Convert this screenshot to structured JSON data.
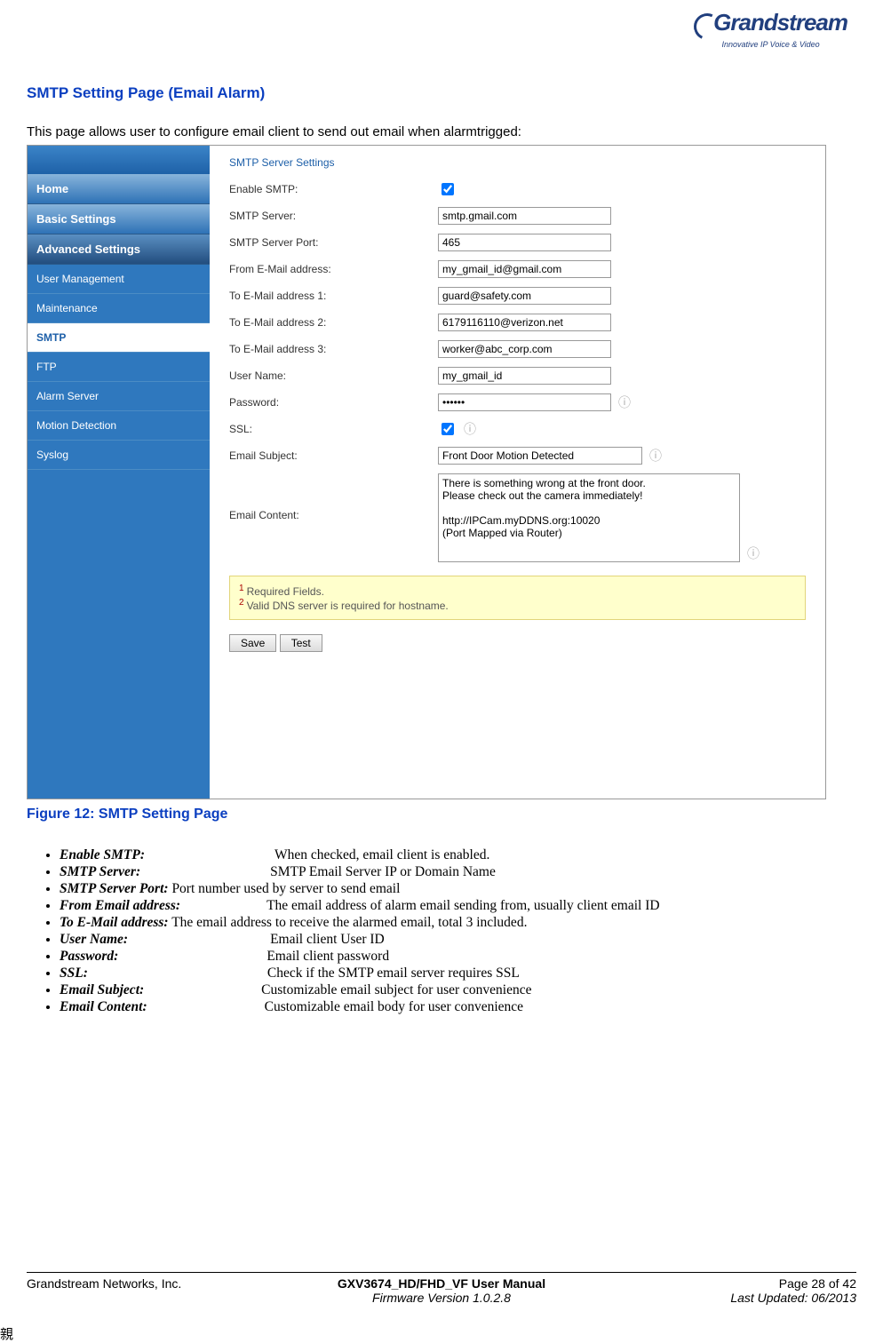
{
  "logo": {
    "brand": "Grandstream",
    "tagline": "Innovative IP Voice & Video"
  },
  "section_title": "SMTP Setting Page (Email Alarm)",
  "intro_text": "This page allows user to configure email client to send out email when alarmtrigged:",
  "sidebar": {
    "top_sections": [
      "Home",
      "Basic Settings",
      "Advanced Settings"
    ],
    "items": [
      "User Management",
      "Maintenance",
      "SMTP",
      "FTP",
      "Alarm Server",
      "Motion Detection",
      "Syslog"
    ],
    "active_index": 2
  },
  "panel": {
    "heading": "SMTP Server Settings",
    "labels": {
      "enable": "Enable SMTP:",
      "server": "SMTP Server:",
      "port": "SMTP Server Port:",
      "from": "From E-Mail address:",
      "to1": "To E-Mail address 1:",
      "to2": "To E-Mail address 2:",
      "to3": "To E-Mail address 3:",
      "user": "User Name:",
      "pass": "Password:",
      "ssl": "SSL:",
      "subj": "Email Subject:",
      "body": "Email Content:"
    },
    "values": {
      "enable": true,
      "server": "smtp.gmail.com",
      "port": "465",
      "from": "my_gmail_id@gmail.com",
      "to1": "guard@safety.com",
      "to2": "6179116110@verizon.net",
      "to3": "worker@abc_corp.com",
      "user": "my_gmail_id",
      "pass": "••••••",
      "ssl": true,
      "subj": "Front Door Motion Detected",
      "body": "There is something wrong at the front door.\nPlease check out the camera immediately!\n\nhttp://IPCam.myDDNS.org:10020\n(Port Mapped via Router)"
    },
    "notes": [
      "Required Fields.",
      "Valid DNS server is required for hostname."
    ],
    "buttons": {
      "save": "Save",
      "test": "Test"
    }
  },
  "fig_caption": "Figure 12:  SMTP Setting Page",
  "definitions": [
    {
      "term": "Enable SMTP:",
      "desc": "When checked, email client is enabled."
    },
    {
      "term": "SMTP Server:",
      "desc": "SMTP Email Server IP or Domain Name"
    },
    {
      "term": "SMTP Server Port:",
      "desc": "Port number used by server to send email",
      "inline": true
    },
    {
      "term": "From Email address:",
      "desc": "The email address of alarm email sending from, usually client email ID"
    },
    {
      "term": "To E-Mail address:",
      "desc": "The email address to receive the alarmed email, total 3 included.",
      "inline": true
    },
    {
      "term": "User Name:",
      "desc": "Email client User ID"
    },
    {
      "term": "Password:",
      "desc": "Email client password"
    },
    {
      "term": "SSL:",
      "desc": "Check if the SMTP email server requires SSL"
    },
    {
      "term": "Email Subject:",
      "desc": "Customizable email subject for user convenience"
    },
    {
      "term": "Email Content:",
      "desc": "Customizable email body for user convenience"
    }
  ],
  "footer": {
    "left": "Grandstream Networks, Inc.",
    "center1": "GXV3674_HD/FHD_VF User Manual",
    "center2": "Firmware Version 1.0.2.8",
    "right1": "Page 28 of 42",
    "right2": "Last Updated: 06/2013"
  }
}
